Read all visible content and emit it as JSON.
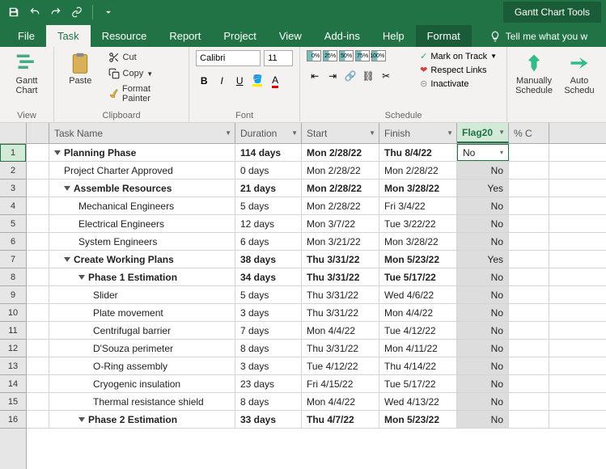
{
  "titlebar": {
    "context_tools": "Gantt Chart Tools"
  },
  "tabs": {
    "file": "File",
    "task": "Task",
    "resource": "Resource",
    "report": "Report",
    "project": "Project",
    "view": "View",
    "addins": "Add-ins",
    "help": "Help",
    "format": "Format",
    "tellme": "Tell me what you w"
  },
  "ribbon": {
    "view_group": "View",
    "gantt_chart": "Gantt\nChart",
    "clipboard_group": "Clipboard",
    "paste": "Paste",
    "cut": "Cut",
    "copy": "Copy",
    "format_painter": "Format Painter",
    "font_group": "Font",
    "font_name": "Calibri",
    "font_size": "11",
    "schedule_group": "Schedule",
    "mark_on_track": "Mark on Track",
    "respect_links": "Respect Links",
    "inactivate": "Inactivate",
    "manually_schedule": "Manually\nSchedule",
    "auto_schedule": "Auto\nSchedu",
    "pct": [
      "0%",
      "25%",
      "50%",
      "75%",
      "100%"
    ]
  },
  "columns": {
    "task_name": "Task Name",
    "duration": "Duration",
    "start": "Start",
    "finish": "Finish",
    "flag": "Flag20",
    "pct": "% C"
  },
  "rows": [
    {
      "n": 1,
      "name": "Planning Phase",
      "dur": "114 days",
      "start": "Mon 2/28/22",
      "finish": "Thu 8/4/22",
      "flag": "No",
      "bold": true,
      "indent": 0,
      "summary": true
    },
    {
      "n": 2,
      "name": "Project Charter Approved",
      "dur": "0 days",
      "start": "Mon 2/28/22",
      "finish": "Mon 2/28/22",
      "flag": "No",
      "bold": false,
      "indent": 1,
      "summary": false
    },
    {
      "n": 3,
      "name": "Assemble Resources",
      "dur": "21 days",
      "start": "Mon 2/28/22",
      "finish": "Mon 3/28/22",
      "flag": "Yes",
      "bold": true,
      "indent": 1,
      "summary": true
    },
    {
      "n": 4,
      "name": "Mechanical Engineers",
      "dur": "5 days",
      "start": "Mon 2/28/22",
      "finish": "Fri 3/4/22",
      "flag": "No",
      "bold": false,
      "indent": 2,
      "summary": false
    },
    {
      "n": 5,
      "name": "Electrical Engineers",
      "dur": "12 days",
      "start": "Mon 3/7/22",
      "finish": "Tue 3/22/22",
      "flag": "No",
      "bold": false,
      "indent": 2,
      "summary": false
    },
    {
      "n": 6,
      "name": "System Engineers",
      "dur": "6 days",
      "start": "Mon 3/21/22",
      "finish": "Mon 3/28/22",
      "flag": "No",
      "bold": false,
      "indent": 2,
      "summary": false
    },
    {
      "n": 7,
      "name": "Create Working Plans",
      "dur": "38 days",
      "start": "Thu 3/31/22",
      "finish": "Mon 5/23/22",
      "flag": "Yes",
      "bold": true,
      "indent": 1,
      "summary": true
    },
    {
      "n": 8,
      "name": "Phase 1 Estimation",
      "dur": "34 days",
      "start": "Thu 3/31/22",
      "finish": "Tue 5/17/22",
      "flag": "No",
      "bold": true,
      "indent": 2,
      "summary": true
    },
    {
      "n": 9,
      "name": "Slider",
      "dur": "5 days",
      "start": "Thu 3/31/22",
      "finish": "Wed 4/6/22",
      "flag": "No",
      "bold": false,
      "indent": 3,
      "summary": false
    },
    {
      "n": 10,
      "name": "Plate movement",
      "dur": "3 days",
      "start": "Thu 3/31/22",
      "finish": "Mon 4/4/22",
      "flag": "No",
      "bold": false,
      "indent": 3,
      "summary": false
    },
    {
      "n": 11,
      "name": "Centrifugal barrier",
      "dur": "7 days",
      "start": "Mon 4/4/22",
      "finish": "Tue 4/12/22",
      "flag": "No",
      "bold": false,
      "indent": 3,
      "summary": false
    },
    {
      "n": 12,
      "name": "D'Souza perimeter",
      "dur": "8 days",
      "start": "Thu 3/31/22",
      "finish": "Mon 4/11/22",
      "flag": "No",
      "bold": false,
      "indent": 3,
      "summary": false
    },
    {
      "n": 13,
      "name": "O-Ring assembly",
      "dur": "3 days",
      "start": "Tue 4/12/22",
      "finish": "Thu 4/14/22",
      "flag": "No",
      "bold": false,
      "indent": 3,
      "summary": false
    },
    {
      "n": 14,
      "name": "Cryogenic insulation",
      "dur": "23 days",
      "start": "Fri 4/15/22",
      "finish": "Tue 5/17/22",
      "flag": "No",
      "bold": false,
      "indent": 3,
      "summary": false
    },
    {
      "n": 15,
      "name": "Thermal resistance shield",
      "dur": "8 days",
      "start": "Mon 4/4/22",
      "finish": "Wed 4/13/22",
      "flag": "No",
      "bold": false,
      "indent": 3,
      "summary": false
    },
    {
      "n": 16,
      "name": "Phase 2 Estimation",
      "dur": "33 days",
      "start": "Thu 4/7/22",
      "finish": "Mon 5/23/22",
      "flag": "No",
      "bold": true,
      "indent": 2,
      "summary": true
    }
  ]
}
